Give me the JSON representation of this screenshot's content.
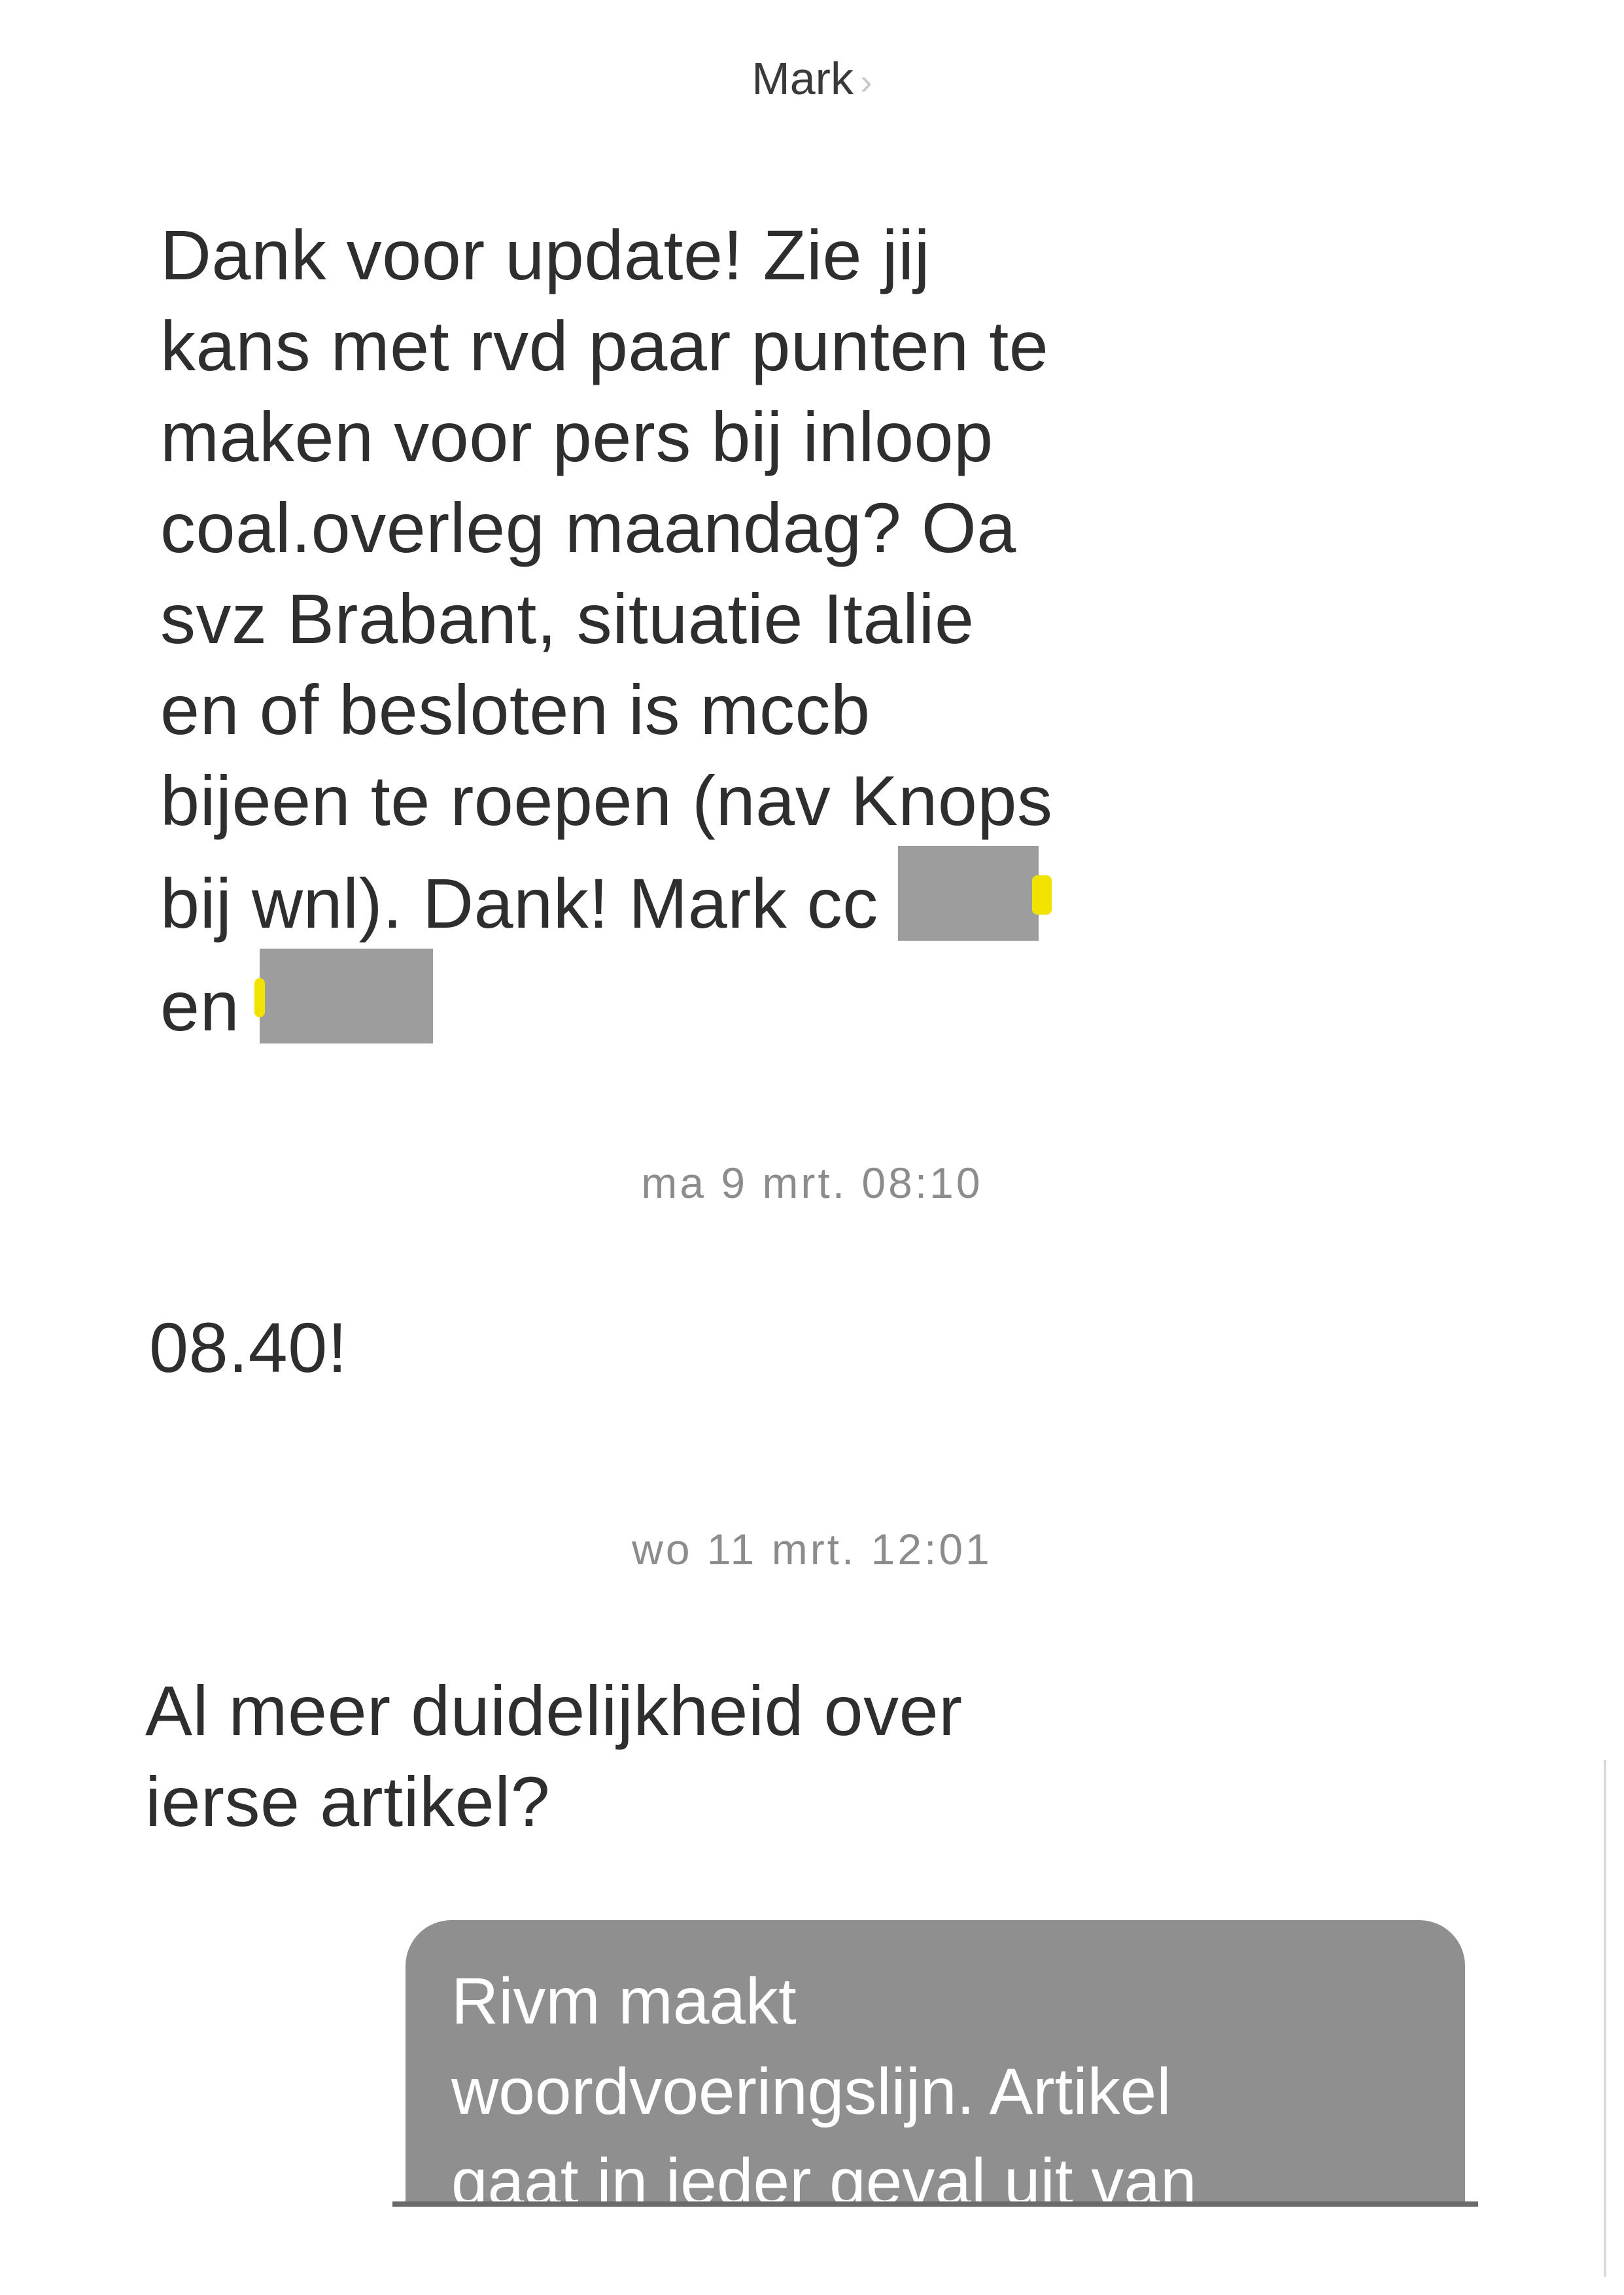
{
  "header": {
    "contact_name": "Mark",
    "chevron": "›"
  },
  "messages": {
    "m1": {
      "lines": [
        "Dank voor update! Zie jij",
        "kans met rvd paar punten te",
        "maken voor pers bij inloop",
        "coal.overleg maandag? Oa",
        "svz Brabant, situatie Italie",
        "en of besloten is mccb",
        "bijeen te roepen (nav Knops",
        "bij wnl). Dank! Mark cc"
      ],
      "last_line": "en"
    },
    "ts1": "ma 9 mrt. 08:10",
    "m2": "08.40!",
    "ts2": "wo 11 mrt. 12:01",
    "m3": {
      "lines": [
        "Al meer duidelijkheid over",
        "ierse artikel?"
      ]
    },
    "m4": {
      "lines": [
        "Rivm maakt",
        "woordvoeringslijn. Artikel",
        "gaat in ieder geval uit van"
      ]
    }
  },
  "colors": {
    "text": "#2e2e2e",
    "timestamp": "#8c8c8c",
    "outgoing_bubble": "#8f8f8f",
    "redaction": "#9d9d9d",
    "highlight": "#f2e200"
  }
}
